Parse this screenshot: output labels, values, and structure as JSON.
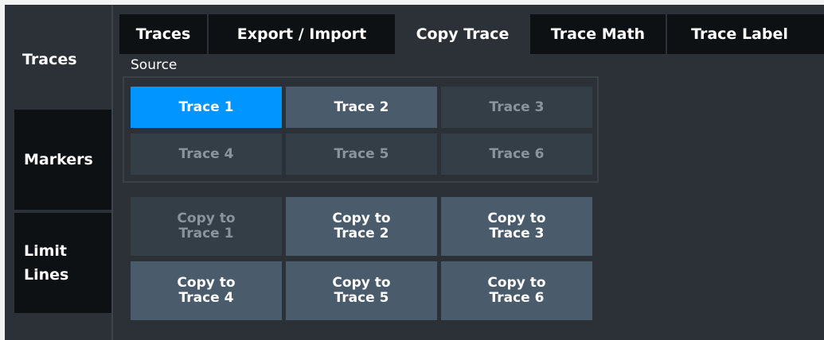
{
  "side_tabs": [
    {
      "label": "Traces",
      "active": true
    },
    {
      "label": "Markers",
      "active": false
    },
    {
      "label": "Limit\nLines",
      "active": false
    }
  ],
  "tabs": [
    {
      "label": "Traces",
      "active": false
    },
    {
      "label": "Export / Import",
      "active": false
    },
    {
      "label": "Copy Trace",
      "active": true
    },
    {
      "label": "Trace Math",
      "active": false
    },
    {
      "label": "Trace Label",
      "active": false
    }
  ],
  "source": {
    "label": "Source",
    "buttons": [
      {
        "label": "Trace 1",
        "state": "selected"
      },
      {
        "label": "Trace 2",
        "state": "normal"
      },
      {
        "label": "Trace 3",
        "state": "dim"
      },
      {
        "label": "Trace 4",
        "state": "dim"
      },
      {
        "label": "Trace 5",
        "state": "dim"
      },
      {
        "label": "Trace 6",
        "state": "dim"
      }
    ]
  },
  "copy": {
    "buttons": [
      {
        "label": "Copy to\nTrace 1",
        "state": "dim"
      },
      {
        "label": "Copy to\nTrace 2",
        "state": "normal"
      },
      {
        "label": "Copy to\nTrace 3",
        "state": "normal"
      },
      {
        "label": "Copy to\nTrace 4",
        "state": "normal"
      },
      {
        "label": "Copy to\nTrace 5",
        "state": "normal"
      },
      {
        "label": "Copy to\nTrace 6",
        "state": "normal"
      }
    ]
  },
  "colors": {
    "background": "#2b3137",
    "selected": "#0095ff",
    "button": "#4a5b6b",
    "button_dim": "#343e47",
    "tab_inactive": "#0e1114"
  }
}
